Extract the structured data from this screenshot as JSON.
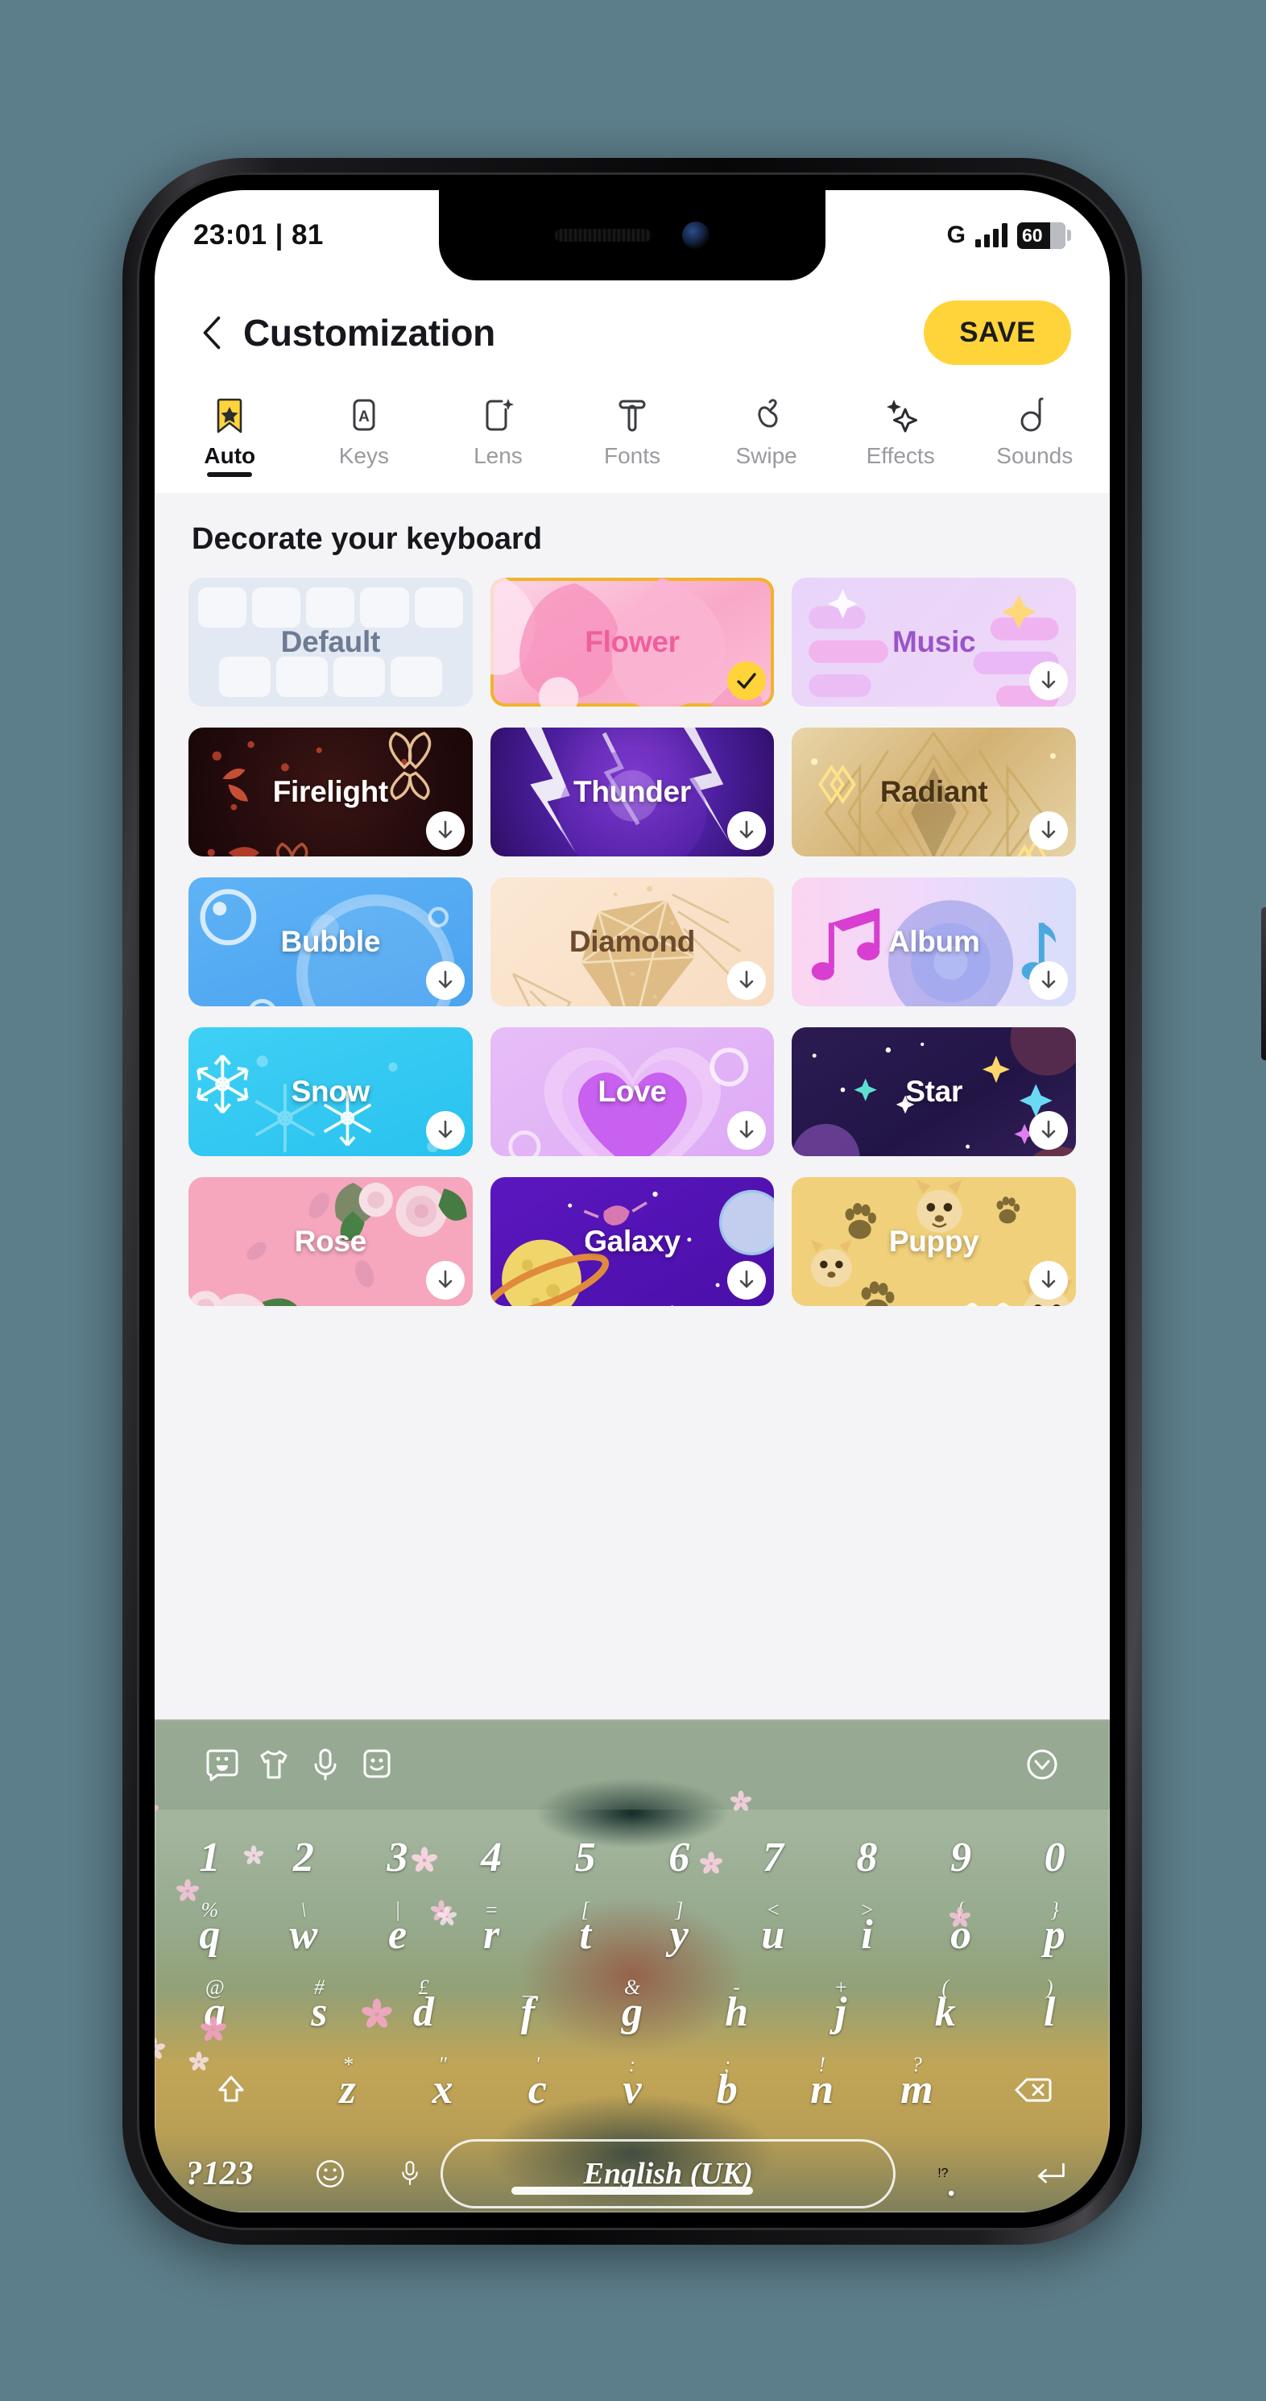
{
  "status_bar": {
    "time_and_date": "23:01 | 81",
    "network_label": "G",
    "battery_percent": "60",
    "signal_icon": "signal-bars-icon",
    "battery_icon": "battery-icon"
  },
  "header": {
    "back_icon": "chevron-left-icon",
    "title": "Customization",
    "save_label": "SAVE",
    "save_color": "#FFD43B"
  },
  "tabs": [
    {
      "label": "Auto",
      "icon": "bookmark-star-icon",
      "active": true
    },
    {
      "label": "Keys",
      "icon": "key-letter-a-icon",
      "active": false
    },
    {
      "label": "Lens",
      "icon": "lens-sparkle-icon",
      "active": false
    },
    {
      "label": "Fonts",
      "icon": "font-t-icon",
      "active": false
    },
    {
      "label": "Swipe",
      "icon": "hand-swipe-icon",
      "active": false
    },
    {
      "label": "Effects",
      "icon": "sparkles-icon",
      "active": false
    },
    {
      "label": "Sounds",
      "icon": "music-note-icon",
      "active": false
    }
  ],
  "content": {
    "section_title": "Decorate your keyboard",
    "themes": [
      {
        "name": "Default",
        "style": "t-default",
        "badge": "none",
        "art": "keyboard-mock"
      },
      {
        "name": "Flower",
        "style": "t-flower",
        "badge": "check",
        "art": "flower-petals",
        "selected": true
      },
      {
        "name": "Music",
        "style": "t-music",
        "badge": "download",
        "art": "music-blocks"
      },
      {
        "name": "Firelight",
        "style": "t-firelight",
        "badge": "download",
        "art": "fire-butterflies"
      },
      {
        "name": "Thunder",
        "style": "t-thunder",
        "badge": "download",
        "art": "lightning"
      },
      {
        "name": "Radiant",
        "style": "t-radiant",
        "badge": "download",
        "art": "gold-diamonds"
      },
      {
        "name": "Bubble",
        "style": "t-bubble",
        "badge": "download",
        "art": "bubbles"
      },
      {
        "name": "Diamond",
        "style": "t-diamond",
        "badge": "download",
        "art": "diamond-gem"
      },
      {
        "name": "Album",
        "style": "t-album",
        "badge": "download",
        "art": "music-notes-disc"
      },
      {
        "name": "Snow",
        "style": "t-snow",
        "badge": "download",
        "art": "snowflakes"
      },
      {
        "name": "Love",
        "style": "t-love",
        "badge": "download",
        "art": "heart"
      },
      {
        "name": "Star",
        "style": "t-star",
        "badge": "download",
        "art": "stars-planets"
      },
      {
        "name": "Rose",
        "style": "t-rose",
        "badge": "download",
        "art": "roses"
      },
      {
        "name": "Galaxy",
        "style": "t-galaxy",
        "badge": "download",
        "art": "planet-space"
      },
      {
        "name": "Puppy",
        "style": "t-puppy",
        "badge": "download",
        "art": "paws-dogs"
      }
    ]
  },
  "keyboard": {
    "toolbar": [
      {
        "icon": "sticker-bubble-icon"
      },
      {
        "icon": "tshirt-icon"
      },
      {
        "icon": "microphone-icon"
      },
      {
        "icon": "smiley-sticker-icon"
      }
    ],
    "collapse_icon": "chevron-down-circle-icon",
    "rows": [
      {
        "keys": [
          {
            "main": "1",
            "sub": ""
          },
          {
            "main": "2",
            "sub": ""
          },
          {
            "main": "3",
            "sub": ""
          },
          {
            "main": "4",
            "sub": ""
          },
          {
            "main": "5",
            "sub": ""
          },
          {
            "main": "6",
            "sub": ""
          },
          {
            "main": "7",
            "sub": ""
          },
          {
            "main": "8",
            "sub": ""
          },
          {
            "main": "9",
            "sub": ""
          },
          {
            "main": "0",
            "sub": ""
          }
        ]
      },
      {
        "keys": [
          {
            "main": "q",
            "sub": "%"
          },
          {
            "main": "w",
            "sub": "\\"
          },
          {
            "main": "e",
            "sub": "|"
          },
          {
            "main": "r",
            "sub": "="
          },
          {
            "main": "t",
            "sub": "["
          },
          {
            "main": "y",
            "sub": "]"
          },
          {
            "main": "u",
            "sub": "<"
          },
          {
            "main": "i",
            "sub": ">"
          },
          {
            "main": "o",
            "sub": "{"
          },
          {
            "main": "p",
            "sub": "}"
          }
        ]
      },
      {
        "keys": [
          {
            "main": "a",
            "sub": "@"
          },
          {
            "main": "s",
            "sub": "#"
          },
          {
            "main": "d",
            "sub": "£"
          },
          {
            "main": "f",
            "sub": "_"
          },
          {
            "main": "g",
            "sub": "&"
          },
          {
            "main": "h",
            "sub": "-"
          },
          {
            "main": "j",
            "sub": "+"
          },
          {
            "main": "k",
            "sub": "("
          },
          {
            "main": "l",
            "sub": ")"
          }
        ]
      },
      {
        "keys": [
          {
            "main": "z",
            "sub": "*"
          },
          {
            "main": "x",
            "sub": "\""
          },
          {
            "main": "c",
            "sub": "'"
          },
          {
            "main": "v",
            "sub": ":"
          },
          {
            "main": "b",
            "sub": ";"
          },
          {
            "main": "n",
            "sub": "!"
          },
          {
            "main": "m",
            "sub": "?"
          }
        ],
        "shift_icon": "shift-arrow-icon",
        "backspace_icon": "backspace-icon"
      }
    ],
    "bottom_row": {
      "symbols_label": "?123",
      "emoji_icon": "smiley-face-icon",
      "mic_icon": "microphone-small-icon",
      "space_label": "English (UK)",
      "period_sub": "!?",
      "period_label": ".",
      "enter_icon": "enter-arrow-icon"
    }
  }
}
